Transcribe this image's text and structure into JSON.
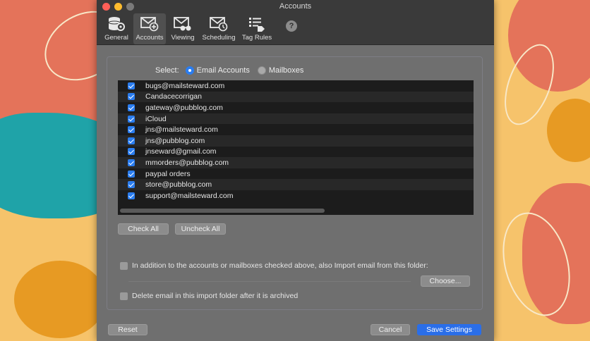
{
  "window": {
    "title": "Accounts"
  },
  "toolbar": {
    "items": [
      {
        "label": "General",
        "icon": "gear-database-icon"
      },
      {
        "label": "Accounts",
        "icon": "mail-plus-icon"
      },
      {
        "label": "Viewing",
        "icon": "mail-binoculars-icon"
      },
      {
        "label": "Scheduling",
        "icon": "mail-clock-icon"
      },
      {
        "label": "Tag Rules",
        "icon": "list-tag-icon"
      }
    ],
    "help": "?"
  },
  "select": {
    "label": "Select:",
    "options": [
      "Email Accounts",
      "Mailboxes"
    ],
    "selected": "Email Accounts"
  },
  "accounts": [
    "bugs@mailsteward.com",
    "Candacecorrigan",
    "gateway@pubblog.com",
    "iCloud",
    "jns@mailsteward.com",
    "jns@pubblog.com",
    "jnseward@gmail.com",
    "mmorders@pubblog.com",
    "paypal orders",
    "store@pubblog.com",
    "support@mailsteward.com"
  ],
  "buttons": {
    "check_all": "Check All",
    "uncheck_all": "Uncheck All",
    "choose": "Choose...",
    "reset": "Reset",
    "cancel": "Cancel",
    "save": "Save Settings"
  },
  "options": {
    "import_folder": "In addition to the accounts or mailboxes checked above, also Import email from this folder:",
    "delete_after": "Delete email in this import folder after it is archived"
  },
  "colors": {
    "accent": "#2a7df0",
    "primary_button": "#2a6ee8"
  }
}
